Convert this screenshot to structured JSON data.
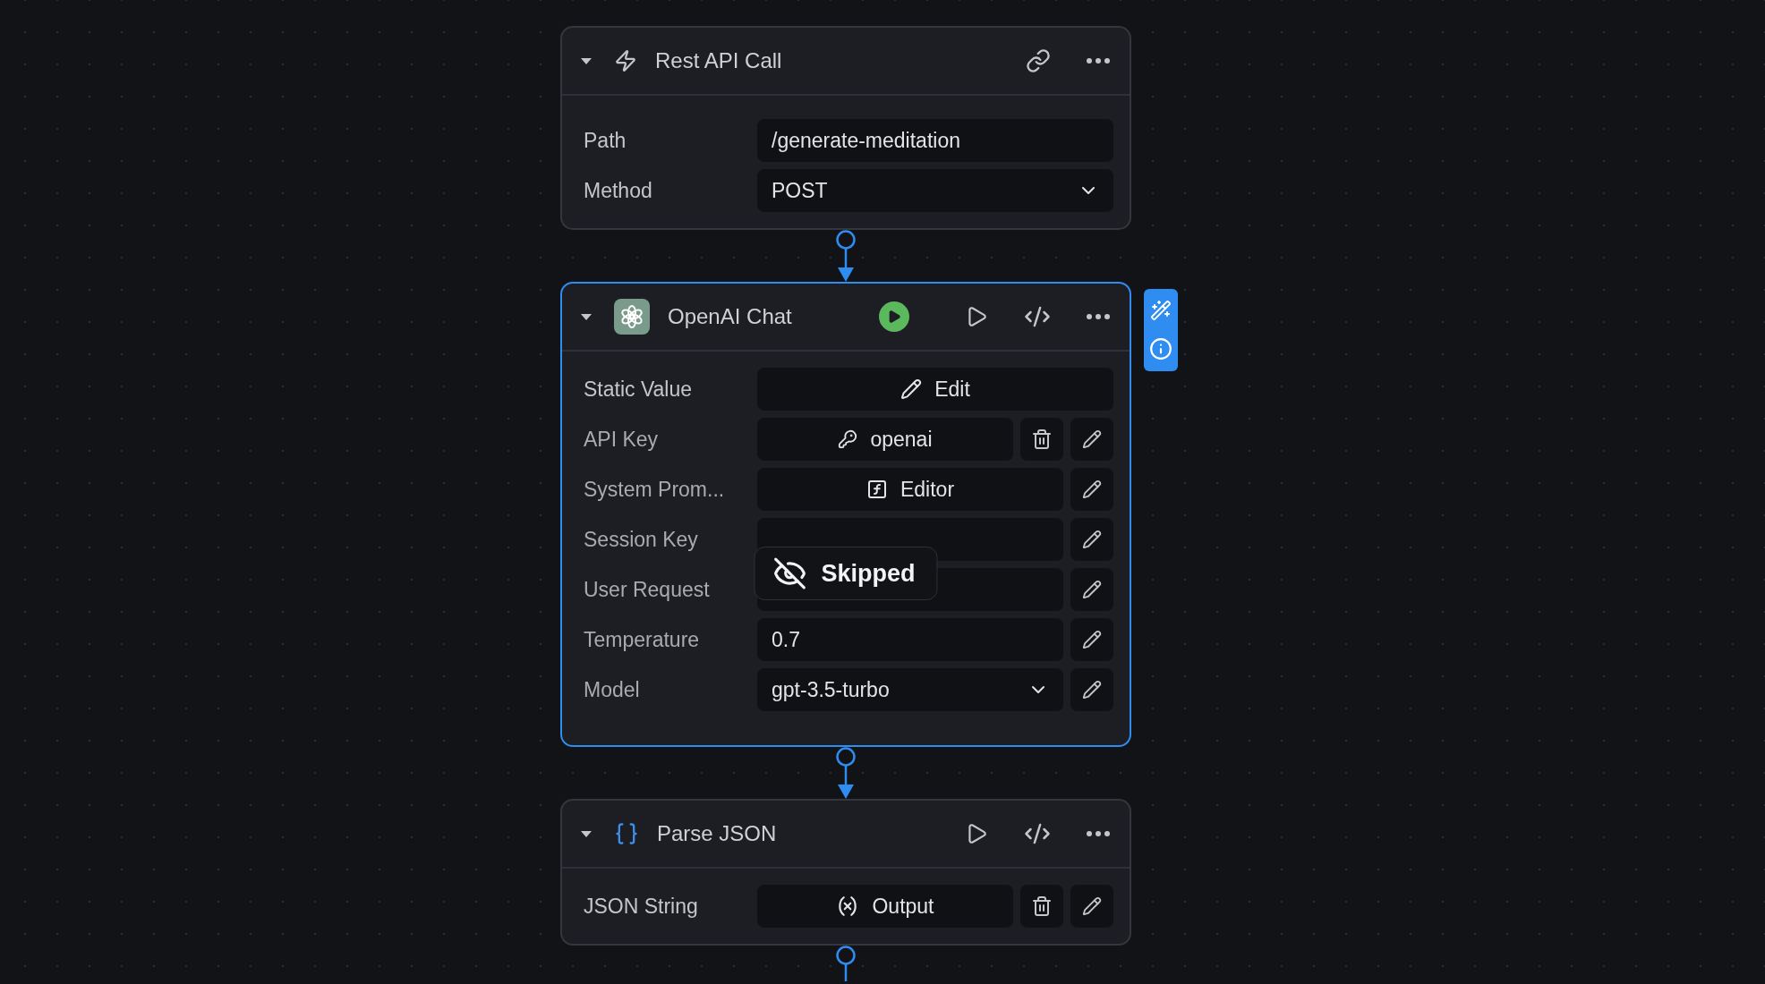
{
  "nodes": [
    {
      "kind": "trigger",
      "title": "Rest API Call",
      "selected": false,
      "skipped": false,
      "expanded": true,
      "fields": [
        {
          "label": "Path",
          "kind": "text",
          "value": "/generate-meditation",
          "trash": false,
          "edit": false
        },
        {
          "label": "Method",
          "kind": "select",
          "value": "POST",
          "trash": false,
          "edit": false
        }
      ]
    },
    {
      "kind": "ai",
      "title": "OpenAI Chat",
      "selected": true,
      "skipped": true,
      "skipped_label": "Skipped",
      "expanded": true,
      "fields": [
        {
          "label": "Static Value",
          "kind": "edit",
          "value": "Edit",
          "trash": false,
          "edit": false
        },
        {
          "label": "API Key",
          "kind": "key",
          "value": "openai",
          "trash": true,
          "edit": true
        },
        {
          "label": "System Prom...",
          "kind": "formula",
          "value": "Editor",
          "trash": false,
          "edit": true
        },
        {
          "label": "Session Key",
          "kind": "text",
          "trash": false,
          "edit": true
        },
        {
          "label": "User Request",
          "kind": "formula",
          "trash": false,
          "edit": true
        },
        {
          "label": "Temperature",
          "kind": "text",
          "value": "0.7",
          "trash": false,
          "edit": true
        },
        {
          "label": "Model",
          "kind": "select",
          "value": "gpt-3.5-turbo",
          "trash": false,
          "edit": true
        }
      ]
    },
    {
      "kind": "parser",
      "title": "Parse JSON",
      "selected": false,
      "skipped": false,
      "expanded": true,
      "fields": [
        {
          "label": "JSON String",
          "kind": "variable",
          "value": "Output",
          "trash": true,
          "edit": true
        }
      ]
    }
  ]
}
